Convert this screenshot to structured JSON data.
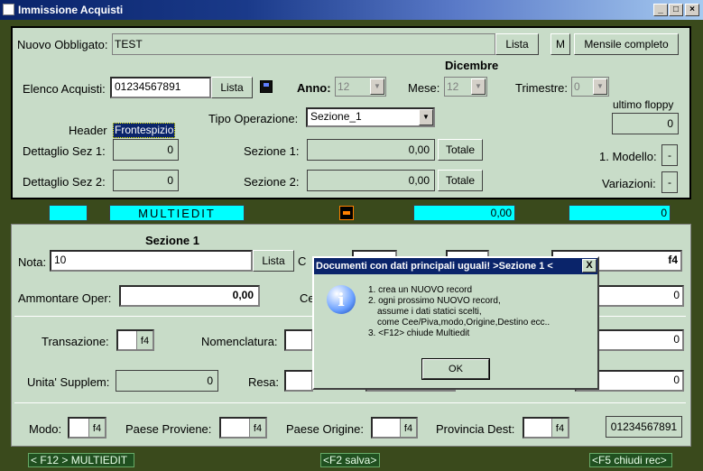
{
  "window": {
    "title": "Immissione  Acquisti"
  },
  "top": {
    "nuovo_obbligato_label": "Nuovo Obbligato:",
    "nuovo_obbligato_value": "TEST",
    "lista1": "Lista",
    "m_btn": "M",
    "mensile_btn": "Mensile completo",
    "month_title": "Dicembre",
    "elenco_label": "Elenco Acquisti:",
    "elenco_value": "01234567891",
    "lista2": "Lista",
    "anno_label": "Anno:",
    "anno_value": "12",
    "mese_label": "Mese:",
    "mese_value": "12",
    "trimestre_label": "Trimestre:",
    "trimestre_value": "0",
    "ultimo_floppy_label": "ultimo floppy",
    "ultimo_floppy_value": "0",
    "header_label": "Header",
    "frontespizio": "Frontespizio",
    "tipo_op_label": "Tipo Operazione:",
    "tipo_op_value": "Sezione_1",
    "dett1_label": "Dettaglio Sez 1:",
    "dett1_value": "0",
    "sez1_label": "Sezione 1:",
    "sez1_value": "0,00",
    "totale1": "Totale",
    "modello_label": "1. Modello:",
    "modello_value": "-",
    "dett2_label": "Dettaglio Sez 2:",
    "dett2_value": "0",
    "sez2_label": "Sezione 2:",
    "sez2_value": "0,00",
    "totale2": "Totale",
    "variazioni_label": "Variazioni:",
    "variazioni_value": "-"
  },
  "band": {
    "multiedit": "MULTIEDIT",
    "value1": "0,00",
    "value2": "0"
  },
  "section": {
    "title": "Sezione 1",
    "nota_label": "Nota:",
    "nota_value": "10",
    "lista3": "Lista",
    "f4_top": "f4",
    "ammontare_label": "Ammontare Oper:",
    "ammontare_value": "0,00",
    "ce_label": "Ce",
    "right_val1": "0",
    "transazione_label": "Transazione:",
    "f4": "f4",
    "nomenclatura_label": "Nomenclatura:",
    "right_val2": "0",
    "unita_label": "Unita' Supplem:",
    "unita_value": "0",
    "resa_label": "Resa:",
    "right_val3": "0",
    "modo_label": "Modo:",
    "paese_prov_label": "Paese Proviene:",
    "paese_orig_label": "Paese Origine:",
    "prov_dest_label": "Provincia Dest:",
    "piva_value": "01234567891"
  },
  "dialog": {
    "title": "Documenti con dati principali uguali! >Sezione 1 <",
    "line1": "1. crea un NUOVO record",
    "line2": "2. ogni prossimo NUOVO record,",
    "line2b": "assume i dati statici scelti,",
    "line2c": "come Cee/Piva,modo,Origine,Destino ecc..",
    "line3": "3. <F12> chiude Multiedit",
    "ok": "OK",
    "close": "X"
  },
  "status": {
    "f12": "< F12 > MULTIEDIT",
    "f2": "<F2 salva>",
    "f5": "<F5 chiudi rec>"
  }
}
